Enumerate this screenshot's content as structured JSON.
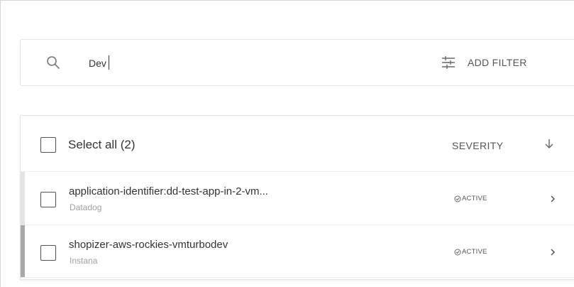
{
  "search": {
    "value": "Dev",
    "add_filter_label": "ADD FILTER"
  },
  "list": {
    "select_all_label": "Select all (2)",
    "sort_label": "SEVERITY",
    "rows": [
      {
        "title": "application-identifier:dd-test-app-in-2-vm...",
        "source": "Datadog",
        "status": "ACTIVE",
        "bar_color": "#e3e3e3"
      },
      {
        "title": "shopizer-aws-rockies-vmturbodev",
        "source": "Instana",
        "status": "ACTIVE",
        "bar_color": "#a9a9a9"
      }
    ]
  },
  "icons": {
    "search": "search-icon",
    "filter": "sliders-icon",
    "sort": "arrow-down-icon",
    "status": "check-circle-icon",
    "row_open": "chevron-right-icon"
  }
}
